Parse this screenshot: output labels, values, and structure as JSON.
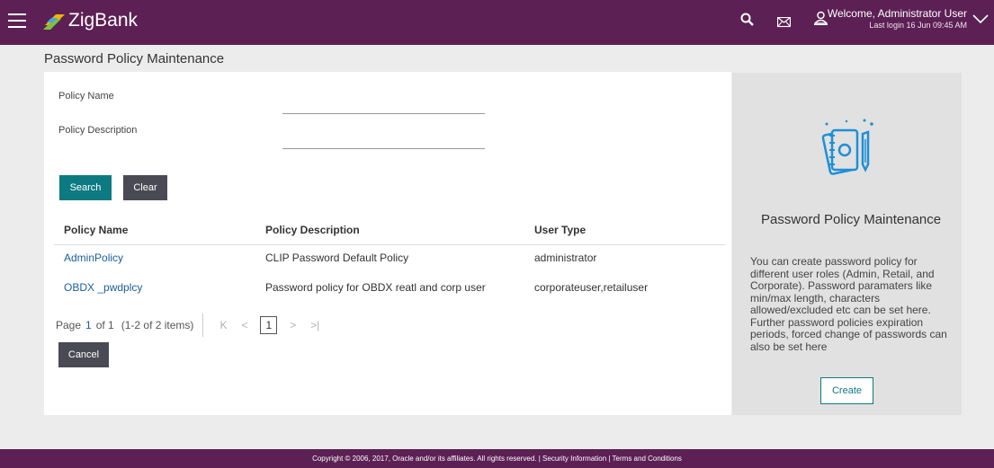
{
  "header": {
    "brand": "ZigBank",
    "welcome": "Welcome, Administrator User",
    "last_login": "Last login 16 Jun 09:45 AM",
    "icons": [
      "menu-icon",
      "search-icon",
      "mail-icon",
      "user-icon",
      "chevron-down-icon"
    ],
    "color": "#5c2054"
  },
  "page": {
    "title": "Password Policy Maintenance"
  },
  "form": {
    "policy_name_label": "Policy Name",
    "policy_description_label": "Policy Description",
    "policy_name_value": "",
    "policy_description_value": "",
    "search_label": "Search",
    "clear_label": "Clear",
    "cancel_label": "Cancel"
  },
  "table": {
    "columns": [
      "Policy Name",
      "Policy Description",
      "User Type"
    ],
    "rows": [
      [
        "AdminPolicy",
        "CLIP Password Default Policy",
        "administrator"
      ],
      [
        "OBDX _pwdplcy",
        "Password policy for OBDX reatl and corp user",
        "corporateuser,retailuser"
      ]
    ]
  },
  "pagination": {
    "page_label": "Page",
    "page": "1",
    "of_label": "of 1",
    "items": "(1-2 of 2 items)",
    "current": "1"
  },
  "side_panel": {
    "title": "Password Policy Maintenance",
    "description": "You can create password policy for different user roles (Admin, Retail, and Corporate). Password paramaters like min/max length, characters allowed/excluded etc can be set here. Further password policies expiration periods, forced change of passwords can also be set here",
    "create_label": "Create",
    "icon": "document-pen-icon"
  },
  "footer": {
    "text": "Copyright © 2006, 2017, Oracle and/or its affiliates. All rights reserved. | Security Information | Terms and Conditions"
  },
  "colors": {
    "primary": "#0d7a82",
    "dark_button": "#4a4a55",
    "link": "#1b5e9e",
    "brand": "#5c2054"
  }
}
